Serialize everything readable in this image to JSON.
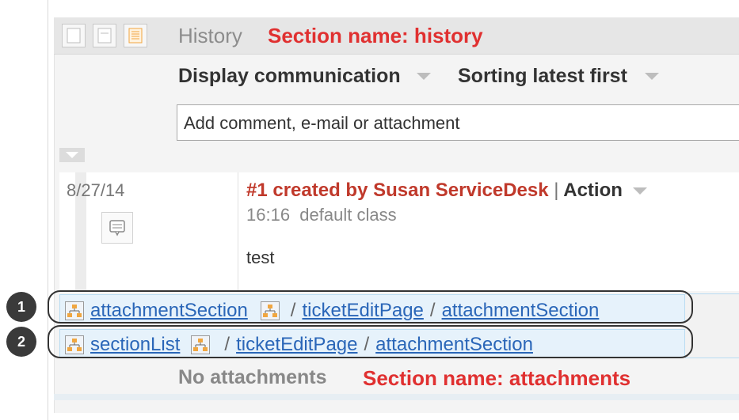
{
  "history": {
    "title": "History",
    "section_note": "Section name: history"
  },
  "toolbar": {
    "display_filter": "Display communication",
    "sorting": "Sorting latest first"
  },
  "comment": {
    "placeholder": "Add comment, e-mail or attachment"
  },
  "entry": {
    "date": "8/27/14",
    "title": "#1 created by Susan ServiceDesk",
    "separator": "|",
    "action_label": "Action",
    "time": "16:16",
    "class_name": "default class",
    "body": "test"
  },
  "rows": [
    {
      "badge": "1",
      "name": "attachmentSection",
      "path": [
        "ticketEditPage",
        "attachmentSection"
      ]
    },
    {
      "badge": "2",
      "name": "sectionList",
      "path": [
        "ticketEditPage",
        "attachmentSection"
      ]
    }
  ],
  "path_separator": "/",
  "attachments": {
    "empty_text": "No attachments",
    "section_note": "Section name: attachments"
  },
  "colors": {
    "note_red": "#e03030",
    "creator_red": "#c0392b",
    "link_blue": "#2a66b8",
    "row_highlight": "#e6f2fb"
  },
  "icons": [
    "view-compact-icon",
    "view-list-icon",
    "view-detail-icon",
    "caret-down-icon",
    "collapse-icon",
    "comment-bubble-icon",
    "tree-structure-icon"
  ]
}
